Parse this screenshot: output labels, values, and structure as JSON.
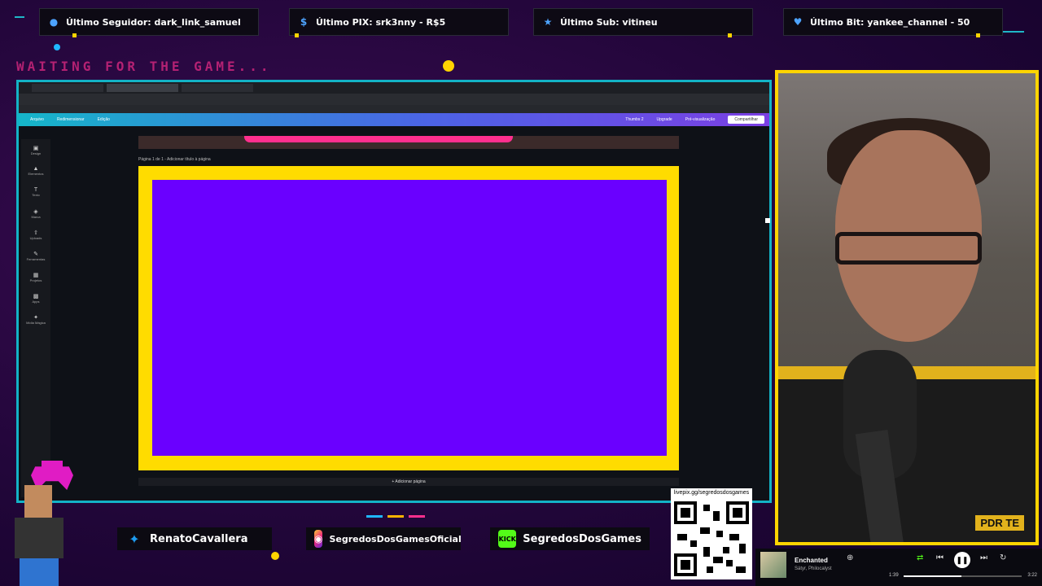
{
  "alerts": [
    {
      "icon": "person-icon",
      "label": "Último Seguidor: dark_link_samuel",
      "color": "#4da3ff"
    },
    {
      "icon": "dollar-icon",
      "label": "Último PIX: srk3nny - R$5",
      "color": "#4da3ff"
    },
    {
      "icon": "star-icon",
      "label": "Último Sub: vitineu",
      "color": "#4da3ff"
    },
    {
      "icon": "diamond-icon",
      "label": "Último Bit: yankee_channel - 50",
      "color": "#4da3ff"
    }
  ],
  "waiting_text": "WAITING FOR THE GAME...",
  "canva": {
    "file_menu": "Arquivo",
    "resize": "Redimensionar",
    "edit": "Edição",
    "title": "Thumbs 2",
    "upgrade": "Upgrade",
    "preview": "Pré-visualização",
    "share": "Compartilhar",
    "page_label": "Página 1 de 1 - Adicionar título à página",
    "add_page": "+ Adicionar página",
    "sidebar": [
      "Design",
      "Elementos",
      "Texto",
      "Marca",
      "Uploads",
      "Ferramentas",
      "Projetos",
      "Apps",
      "Mídia Mágica"
    ]
  },
  "socials": [
    {
      "icon": "twitter-icon",
      "label": "RenatoCavallera",
      "color": "#1d9bf0"
    },
    {
      "icon": "instagram-icon",
      "label": "SegredosDosGamesOficial",
      "color": "#e1306c"
    },
    {
      "icon": "kick-icon",
      "label": "SegredosDosGames",
      "color": "#53fc18",
      "badge": "KICK"
    }
  ],
  "qr": {
    "url": "livepix.gg/segredosdosgames"
  },
  "cam": {
    "shirt_logo": "PDR TE"
  },
  "player": {
    "song": "Enchanted",
    "artist": "Sátyr, Philocalyst",
    "elapsed": "1:39",
    "duration": "3:22",
    "progress": 0.49
  },
  "colors": {
    "accent": "#13b3c6",
    "yellow": "#ffd400",
    "pink": "#ff2f8e",
    "purple": "#6a00ff"
  }
}
